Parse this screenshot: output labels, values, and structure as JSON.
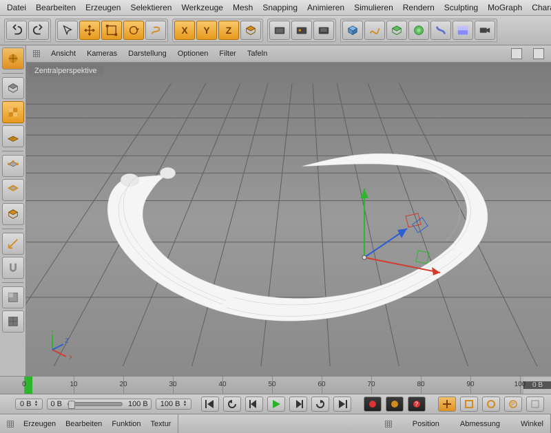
{
  "menubar": [
    "Datei",
    "Bearbeiten",
    "Erzeugen",
    "Selektieren",
    "Werkzeuge",
    "Mesh",
    "Snapping",
    "Animieren",
    "Simulieren",
    "Rendern",
    "Sculpting",
    "MoGraph",
    "Charakt"
  ],
  "viewport_menu": [
    "Ansicht",
    "Kameras",
    "Darstellung",
    "Optionen",
    "Filter",
    "Tafeln"
  ],
  "viewport_label": "Zentralperspektive",
  "mini_axis": {
    "x": "X",
    "y": "Y",
    "z": "Z"
  },
  "timeline": {
    "start": 0,
    "end": 100,
    "marks": [
      0,
      10,
      20,
      30,
      40,
      50,
      60,
      70,
      80,
      90,
      100
    ],
    "current": 0,
    "frames_label": "0 B"
  },
  "transport": {
    "field1": "0 B",
    "range_left": "0 B",
    "range_right": "100 B",
    "field2": "100 B"
  },
  "bottom_left_tabs": [
    "Erzeugen",
    "Bearbeiten",
    "Funktion",
    "Textur"
  ],
  "bottom_right_tabs": [
    "Position",
    "Abmessung",
    "Winkel"
  ],
  "toolbar_axes": [
    "X",
    "Y",
    "Z"
  ],
  "colors": {
    "accent": "#e79a1e",
    "axis_x": "#d43b2d",
    "axis_y": "#2eb52e",
    "axis_z": "#2d5fd4"
  }
}
